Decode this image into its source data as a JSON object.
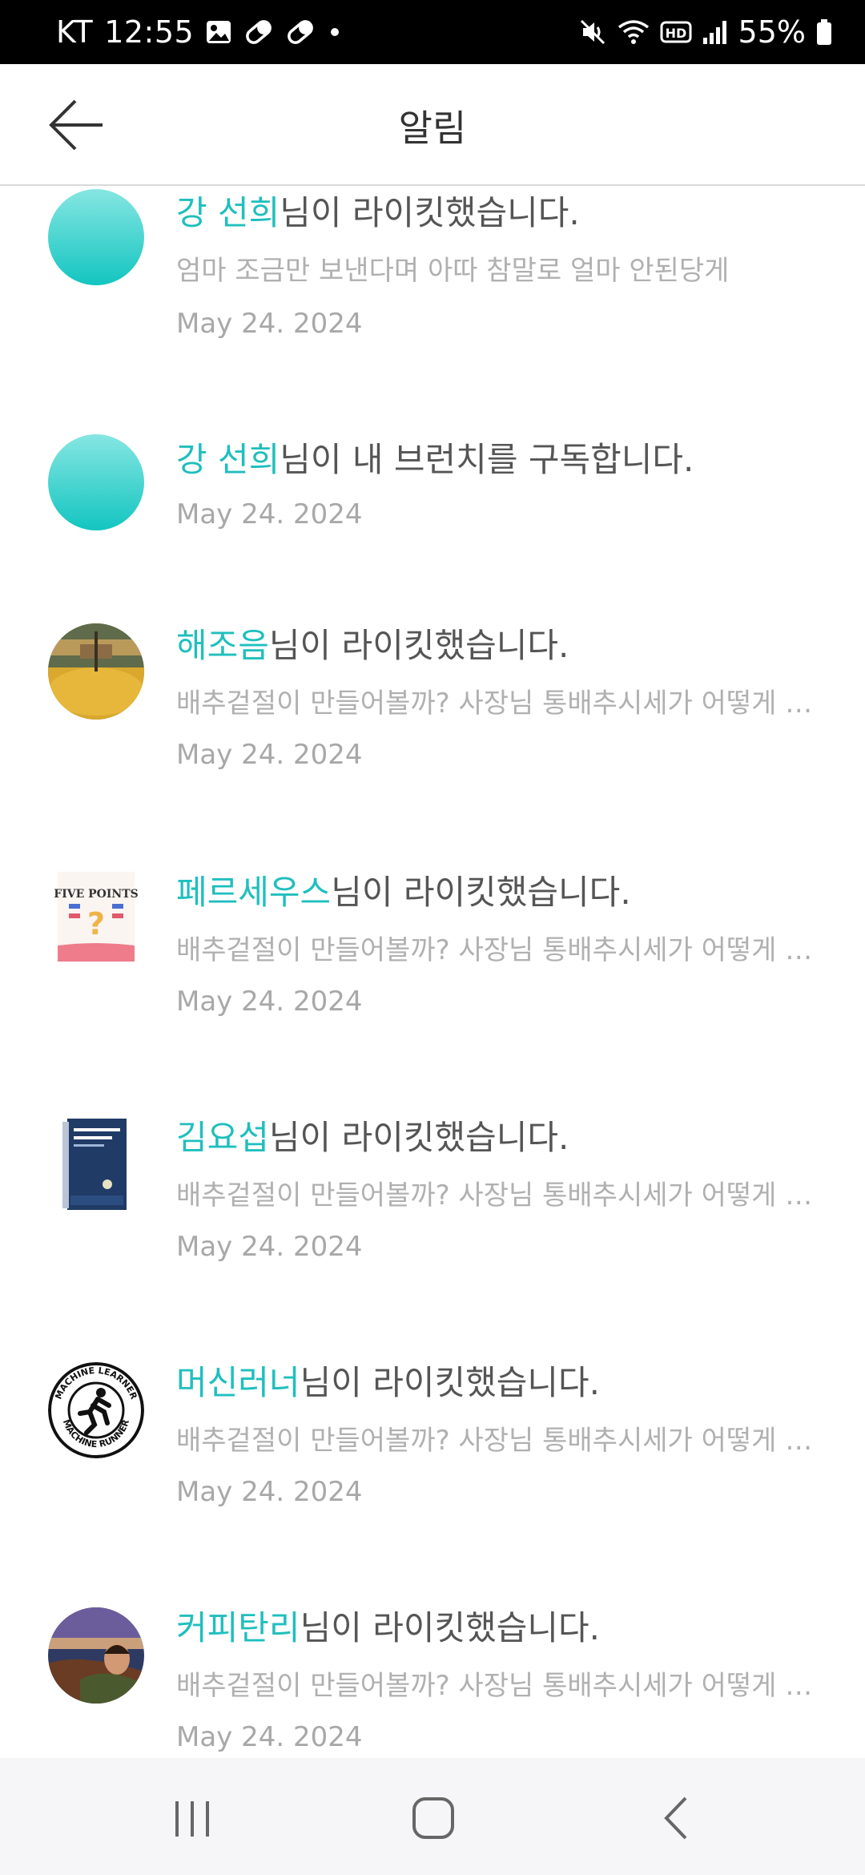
{
  "status_bar": {
    "carrier": "KT",
    "time": "12:55",
    "battery": "55%",
    "icons": [
      "image-icon",
      "pill-icon",
      "pill-icon",
      "dot-icon",
      "mute-icon",
      "wifi-icon",
      "hd-icon",
      "signal-icon",
      "battery-icon"
    ]
  },
  "header": {
    "title": "알림",
    "back_icon": "arrow-left-icon"
  },
  "notifications": [
    {
      "name": "강 선희",
      "action": "님이 라이킷했습니다.",
      "preview": "엄마 조금만 보낸다며 아따 참말로 얼마 안된당게",
      "date": "May 24. 2024",
      "avatar": "teal-gradient-circle"
    },
    {
      "name": "강 선희",
      "action": "님이 내 브런치를 구독합니다.",
      "preview": "",
      "date": "May 24. 2024",
      "avatar": "teal-gradient-circle"
    },
    {
      "name": "해조음",
      "action": "님이 라이킷했습니다.",
      "preview": "배추겉절이 만들어볼까? 사장님 통배추시세가 어떻게 …",
      "date": "May 24. 2024",
      "avatar": "autumn-photo"
    },
    {
      "name": "페르세우스",
      "action": "님이 라이킷했습니다.",
      "preview": "배추겉절이 만들어볼까? 사장님 통배추시세가 어떻게 …",
      "date": "May 24. 2024",
      "avatar": "five-points-book"
    },
    {
      "name": "김요섭",
      "action": "님이 라이킷했습니다.",
      "preview": "배추겉절이 만들어볼까? 사장님 통배추시세가 어떻게 …",
      "date": "May 24. 2024",
      "avatar": "blue-book"
    },
    {
      "name": "머신러너",
      "action": "님이 라이킷했습니다.",
      "preview": "배추겉절이 만들어볼까? 사장님 통배추시세가 어떻게 …",
      "date": "May 24. 2024",
      "avatar": "machine-runner-logo"
    },
    {
      "name": "커피탄리",
      "action": "님이 라이킷했습니다.",
      "preview": "배추겉절이 만들어볼까? 사장님 통배추시세가 어떻게 …",
      "date": "May 24. 2024",
      "avatar": "painting"
    }
  ],
  "logo_text": {
    "five_points": "FIVE POINTS",
    "machine_runner_top": "MACHINE LEARNER",
    "machine_runner_bottom": "MACHINE RUNNER"
  },
  "colors": {
    "accent": "#1fbfbe",
    "text": "#555555",
    "muted": "#b0b0b0"
  },
  "nav_bar": {
    "icons": [
      "recent-apps-icon",
      "home-icon",
      "back-icon"
    ]
  }
}
